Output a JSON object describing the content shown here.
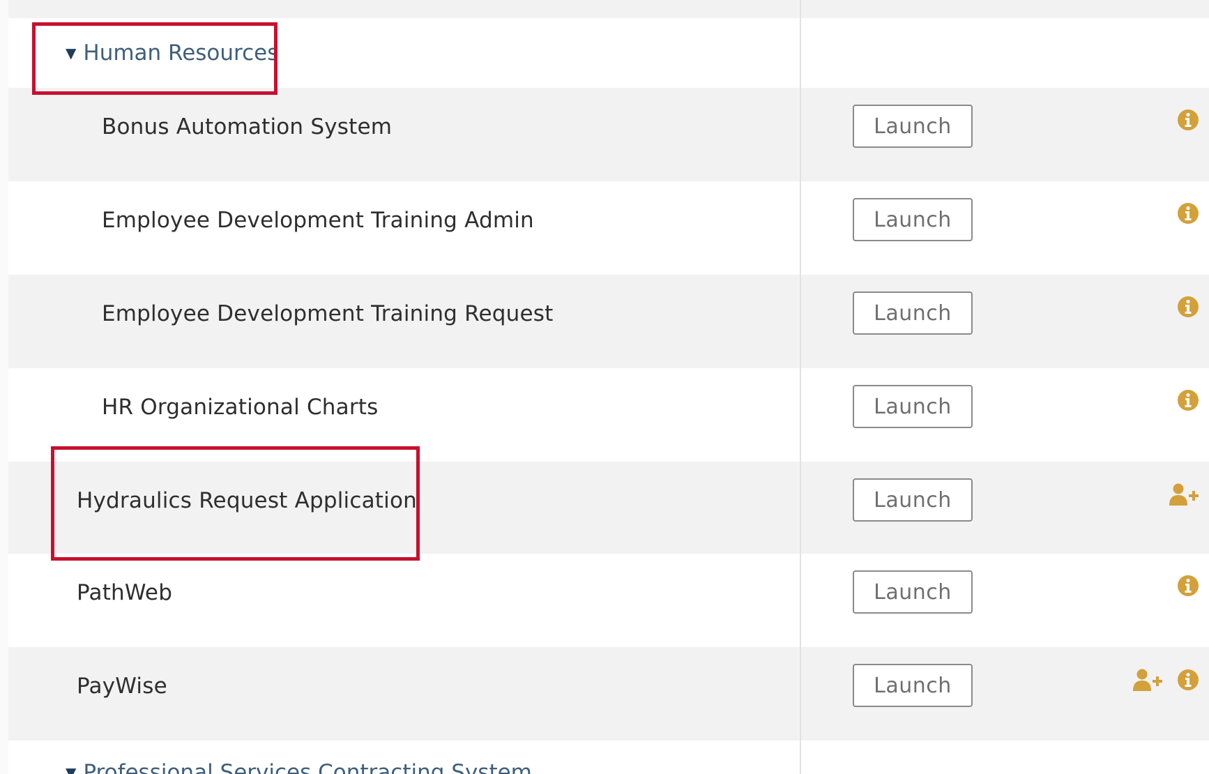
{
  "groups": {
    "hr": {
      "label": "Human Resources",
      "expanded": true
    },
    "pscs": {
      "label": "Professional Services Contracting System",
      "expanded": true
    }
  },
  "apps": [
    {
      "name": "Bonus Automation System",
      "launch_label": "Launch",
      "icons": [
        "info-icon"
      ]
    },
    {
      "name": "Employee Development Training Admin",
      "launch_label": "Launch",
      "icons": [
        "info-icon"
      ]
    },
    {
      "name": "Employee Development Training Request",
      "launch_label": "Launch",
      "icons": [
        "info-icon"
      ]
    },
    {
      "name": "HR Organizational Charts",
      "launch_label": "Launch",
      "icons": [
        "info-icon"
      ]
    },
    {
      "name": "Hydraulics Request Application",
      "launch_label": "Launch",
      "icons": [
        "request-access-icon"
      ]
    },
    {
      "name": "PathWeb",
      "launch_label": "Launch",
      "icons": [
        "info-icon"
      ]
    },
    {
      "name": "PayWise",
      "launch_label": "Launch",
      "icons": [
        "request-access-icon",
        "info-icon"
      ]
    }
  ],
  "colors": {
    "accent_icon": "#d4a03a",
    "highlight": "#c8102e",
    "category_link": "#3f5f7a"
  }
}
